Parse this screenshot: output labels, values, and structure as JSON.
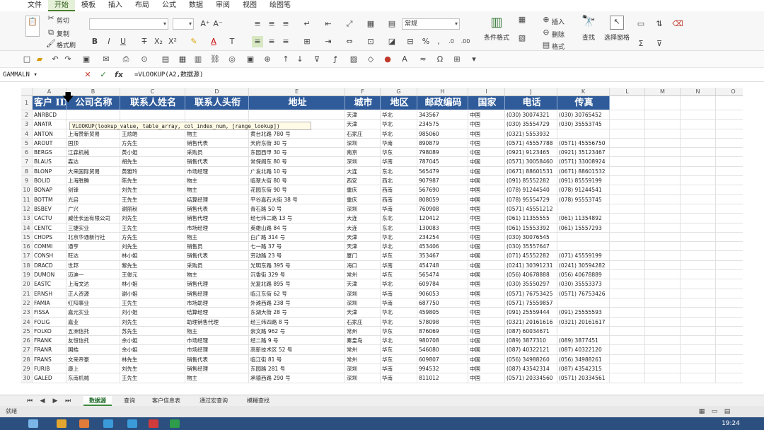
{
  "ribbon": {
    "tabs": [
      "文件",
      "开始",
      "模板",
      "插入",
      "布局",
      "公式",
      "数据",
      "审阅",
      "视图",
      "绘图笔"
    ],
    "active_tab": "开始",
    "clipboard": {
      "cut": "剪切",
      "copy": "复制",
      "format_painter": "格式刷"
    },
    "number_format": "常规",
    "conditional_format": "条件格式",
    "insert": "插入",
    "delete": "删除",
    "format": "格式",
    "find": "查找",
    "select_window": "选择窗格"
  },
  "formula_bar": {
    "name_box": "GAMMALN",
    "formula": "=VLOOKUP(A2,数据源)"
  },
  "tooltip": "VLOOKUP(lookup_value, table_array, col_index_num, [range_lookup])",
  "columns": [
    "A",
    "B",
    "C",
    "D",
    "E",
    "F",
    "G",
    "H",
    "I",
    "J",
    "K",
    "L",
    "M",
    "N",
    "O"
  ],
  "headers": [
    "客户 ID",
    "公司名称",
    "联系人姓名",
    "联系人头衔",
    "地址",
    "城市",
    "地区",
    "邮政编码",
    "国家",
    "电话",
    "传真"
  ],
  "rows": [
    [
      "ANRBCD",
      "",
      "",
      "",
      "",
      "天津",
      "华北",
      "343567",
      "中国",
      "(030) 30074321",
      "(030) 30765452"
    ],
    [
      "ANATR",
      "",
      "",
      "",
      "",
      "天津",
      "华北",
      "234575",
      "中国",
      "(030) 35554729",
      "(030) 35553745"
    ],
    [
      "ANTON",
      "上海赞新贸易",
      "王炫皓",
      "物主",
      "黄台北路 780 号",
      "石家庄",
      "华北",
      "985060",
      "中国",
      "(0321) 5553932",
      ""
    ],
    [
      "AROUT",
      "国顶",
      "方先生",
      "销售代表",
      "天府东街 30 号",
      "深圳",
      "华南",
      "890879",
      "中国",
      "(0571) 45557788",
      "(0571) 45556750"
    ],
    [
      "BERGS",
      "江森机械",
      "黄小姐",
      "采购员",
      "东园西甲 30 号",
      "南京",
      "华东",
      "798089",
      "中国",
      "(0921) 9123465",
      "(0921) 35123467"
    ],
    [
      "BLAUS",
      "森达",
      "胡先生",
      "销售代表",
      "常保阁东 80 号",
      "深圳",
      "华南",
      "787045",
      "中国",
      "(0571) 30058460",
      "(0571) 33008924"
    ],
    [
      "BLONP",
      "大来国际贸易",
      "黄雅玲",
      "市场经理",
      "广发北路 10 号",
      "大连",
      "东北",
      "565479",
      "中国",
      "(0671) 88601531",
      "(0671) 88601532"
    ],
    [
      "BOLID",
      "上海胜腾",
      "陈先生",
      "物主",
      "临翠大街 80 号",
      "西安",
      "西北",
      "907987",
      "中国",
      "(091) 85552282",
      "(091) 85559199"
    ],
    [
      "BONAP",
      "剑锋",
      "刘先生",
      "物主",
      "花园东街 90 号",
      "重庆",
      "西南",
      "567690",
      "中国",
      "(078) 91244540",
      "(078) 91244541"
    ],
    [
      "BOTTM",
      "光启",
      "王先生",
      "结算经理",
      "平谷嘉石大街 38 号",
      "重庆",
      "西南",
      "808059",
      "中国",
      "(078) 95554729",
      "(078) 95553745"
    ],
    [
      "BSBEV",
      "广兴",
      "谢丽秋",
      "销售代表",
      "青石路 50 号",
      "深圳",
      "华南",
      "760908",
      "中国",
      "(0571) 45551212",
      ""
    ],
    [
      "CACTU",
      "威佳长运有限公司",
      "刘先生",
      "销售代理",
      "经七纬二路 13 号",
      "大连",
      "东北",
      "120412",
      "中国",
      "(061) 11355555",
      "(061) 11354892"
    ],
    [
      "CENTC",
      "三捷实业",
      "王先生",
      "市场经理",
      "英雄山路 84 号",
      "大连",
      "东北",
      "130083",
      "中国",
      "(061) 15553392",
      "(061) 15557293"
    ],
    [
      "CHOPS",
      "北京华通新行社",
      "方先生",
      "物主",
      "白广路 314 号",
      "天津",
      "华北",
      "234254",
      "中国",
      "(030) 30076545",
      ""
    ],
    [
      "COMMI",
      "通亨",
      "刘先生",
      "销售员",
      "七一路 37 号",
      "天津",
      "华北",
      "453406",
      "中国",
      "(030) 35557647",
      ""
    ],
    [
      "CONSH",
      "旺达",
      "林小姐",
      "销售代表",
      "劳动路 23 号",
      "厦门",
      "华东",
      "353467",
      "中国",
      "(071) 45552282",
      "(071) 45559199"
    ],
    [
      "DRACD",
      "世邦",
      "黎先生",
      "采购员",
      "光明东路 395 号",
      "海口",
      "华南",
      "454748",
      "中国",
      "(0241) 30391231",
      "(0241) 30594282"
    ],
    [
      "DUMON",
      "迈迪一",
      "王俊元",
      "物主",
      "沉香街 329 号",
      "常州",
      "华东",
      "565474",
      "中国",
      "(056) 40678888",
      "(056) 40678889"
    ],
    [
      "EASTC",
      "上海文达",
      "林小姐",
      "销售代理",
      "光复北路 895 号",
      "天津",
      "华北",
      "609784",
      "中国",
      "(030) 35550297",
      "(030) 35553373"
    ],
    [
      "ERNSH",
      "正人资源",
      "谢小姐",
      "销售经理",
      "临江东街 62 号",
      "深圳",
      "华南",
      "906053",
      "中国",
      "(0571) 76753425",
      "(0571) 76753426"
    ],
    [
      "FAMIA",
      "红阳事业",
      "王先生",
      "市场助理",
      "外滩西路 238 号",
      "深圳",
      "华南",
      "687750",
      "中国",
      "(0571) 75559857",
      ""
    ],
    [
      "FISSA",
      "嘉元实业",
      "刘小姐",
      "结算经理",
      "东湖大街 28 号",
      "天津",
      "华北",
      "459805",
      "中国",
      "(091) 25559444",
      "(091) 25555593"
    ],
    [
      "FOLIG",
      "嘉业",
      "刘先生",
      "助理销售代理",
      "经三纬四路 8 号",
      "石家庄",
      "华北",
      "578098",
      "中国",
      "(0321) 20161616",
      "(0321) 20161617"
    ],
    [
      "FOLKO",
      "五洲信托",
      "苏先生",
      "物主",
      "崇文路 962 号",
      "常州",
      "华东",
      "876069",
      "中国",
      "(087) 60034671",
      ""
    ],
    [
      "FRANK",
      "友恒信托",
      "余小姐",
      "市场经理",
      "经二路 9 号",
      "秦皇岛",
      "华北",
      "980708",
      "中国",
      "(089) 3877310",
      "(089) 3877451"
    ],
    [
      "FRANR",
      "国皓",
      "余小姐",
      "市场经理",
      "高新技术区 52 号",
      "常州",
      "华东",
      "546080",
      "中国",
      "(087) 40322121",
      "(087) 40322120"
    ],
    [
      "FRANS",
      "文来帝豪",
      "林先生",
      "销售代表",
      "临江街 81 号",
      "常州",
      "华东",
      "609807",
      "中国",
      "(056) 34988260",
      "(056) 34988261"
    ],
    [
      "FURIB",
      "康上",
      "刘先生",
      "销售经理",
      "东园路 281 号",
      "深圳",
      "华南",
      "994532",
      "中国",
      "(087) 43542314",
      "(087) 43542315"
    ],
    [
      "GALED",
      "东南机械",
      "王先生",
      "物主",
      "承德西路 290 号",
      "深圳",
      "华南",
      "811012",
      "中国",
      "(0571) 20334560",
      "(0571) 20334561"
    ]
  ],
  "sheet_tabs": [
    "数据源",
    "查询",
    "客户信息表",
    "通过宏查询",
    "模糊查找"
  ],
  "active_sheet": "数据源",
  "status_left": "就绪",
  "clock": "19:24"
}
